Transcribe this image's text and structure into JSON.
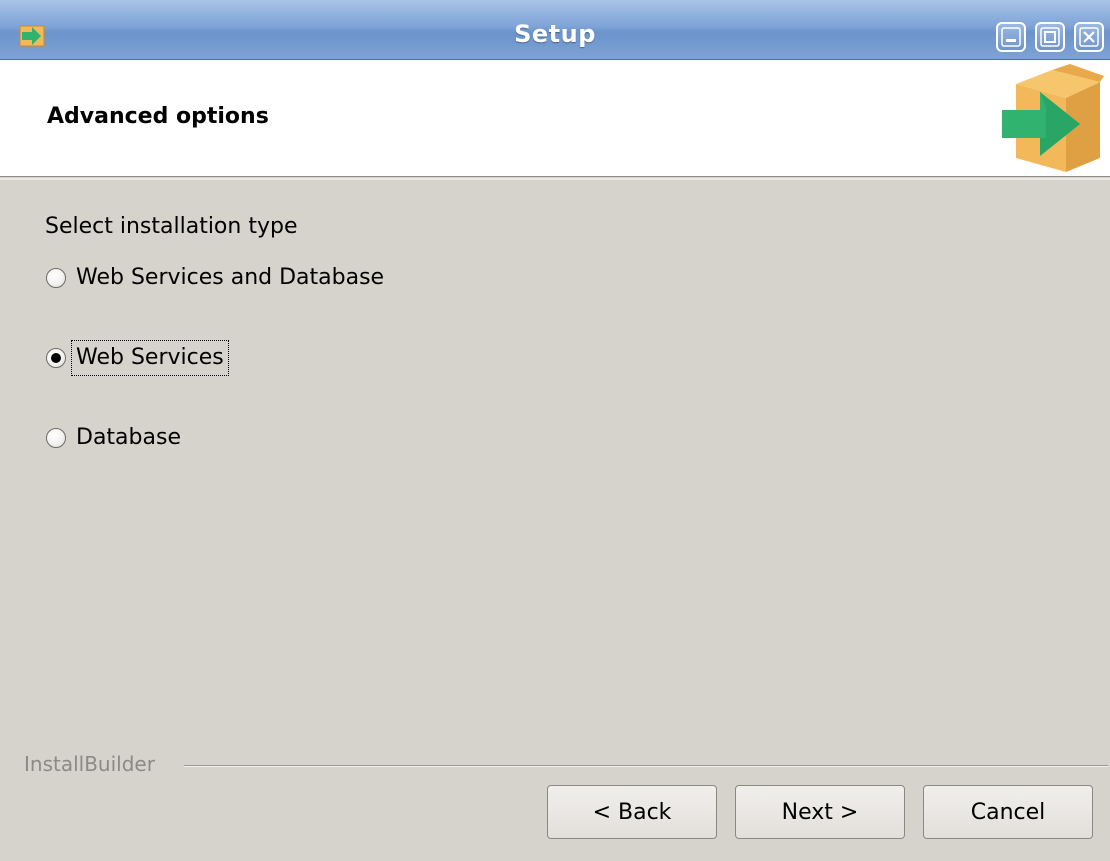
{
  "window": {
    "title": "Setup"
  },
  "header": {
    "title": "Advanced options"
  },
  "body": {
    "prompt": "Select installation type",
    "options": [
      {
        "label": "Web Services and Database",
        "selected": false
      },
      {
        "label": "Web Services",
        "selected": true
      },
      {
        "label": "Database",
        "selected": false
      }
    ]
  },
  "footer": {
    "brand": "InstallBuilder",
    "back_label": "< Back",
    "next_label": "Next >",
    "cancel_label": "Cancel"
  },
  "colors": {
    "titlebar": "#7ea3d6",
    "background": "#d6d2cc",
    "logo_box": "#f2b85a",
    "logo_arrow": "#2fb36f"
  },
  "icons": {
    "app": "installer-box-icon",
    "minimize": "minimize-icon",
    "maximize": "maximize-icon",
    "close": "close-icon",
    "logo": "installer-box-logo"
  }
}
